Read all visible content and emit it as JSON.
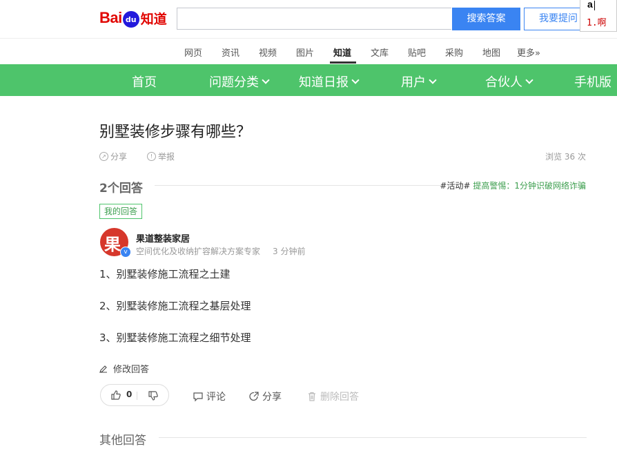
{
  "header": {
    "logo_bai": "Bai",
    "logo_du": "du",
    "logo_zhidao": "知道",
    "search_value": "",
    "search_button": "搜索答案",
    "ask_button": "我要提问"
  },
  "ime": {
    "composition": "a",
    "candidate": "1.啊"
  },
  "nav": {
    "items": [
      "网页",
      "资讯",
      "视频",
      "图片",
      "知道",
      "文库",
      "贴吧",
      "采购",
      "地图",
      "更多»"
    ],
    "active": "知道"
  },
  "green_nav": {
    "items": [
      "首页",
      "问题分类",
      "知道日报",
      "用户",
      "合伙人",
      "手机版"
    ]
  },
  "question": {
    "title": "别墅装修步骤有哪些？",
    "share": "分享",
    "report": "举报",
    "views": "浏览 36 次"
  },
  "answers": {
    "count_label": "2个回答",
    "activity_tag": "#活动#",
    "activity_text": "提高警惕：1分钟识破网络诈骗",
    "my_answer_tag": "我的回答",
    "author": {
      "name": "果道整装家居",
      "title": "空间优化及收纳扩容解决方案专家",
      "time": "3 分钟前",
      "avatar_glyph": "果"
    },
    "paragraphs": [
      "1、别墅装修施工流程之土建",
      "2、别墅装修施工流程之基层处理",
      "3、别墅装修施工流程之细节处理"
    ],
    "edit_label": "修改回答",
    "like_count": "0",
    "comment_label": "评论",
    "share_label": "分享",
    "delete_label": "删除回答",
    "other_answers": "其他回答"
  },
  "colors": {
    "accent_green": "#4ec46b",
    "search_blue": "#3a84f2",
    "logo_red": "#e10602"
  }
}
